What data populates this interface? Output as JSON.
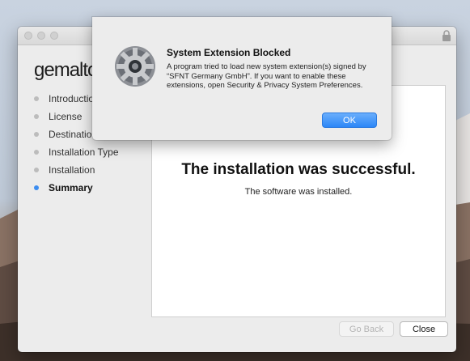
{
  "installer": {
    "logo_text": "gemalto",
    "steps": [
      {
        "label": "Introduction",
        "active": false
      },
      {
        "label": "License",
        "active": false
      },
      {
        "label": "Destination Select",
        "active": false
      },
      {
        "label": "Installation Type",
        "active": false
      },
      {
        "label": "Installation",
        "active": false
      },
      {
        "label": "Summary",
        "active": true
      }
    ],
    "success_title": "The installation was successful.",
    "success_subtitle": "The software was installed.",
    "buttons": {
      "back": "Go Back",
      "close": "Close"
    }
  },
  "alert": {
    "title": "System Extension Blocked",
    "body": "A program tried to load new system extension(s) signed by “SFNT Germany GmbH”.  If you want to enable these extensions, open Security & Privacy System Preferences.",
    "ok_label": "OK"
  },
  "colors": {
    "accent": "#2c87f7",
    "success": "#57b54c",
    "active_step": "#3c8df0"
  },
  "icons": {
    "window_lock": "lock-icon",
    "alert": "system-preferences-gear-icon"
  }
}
